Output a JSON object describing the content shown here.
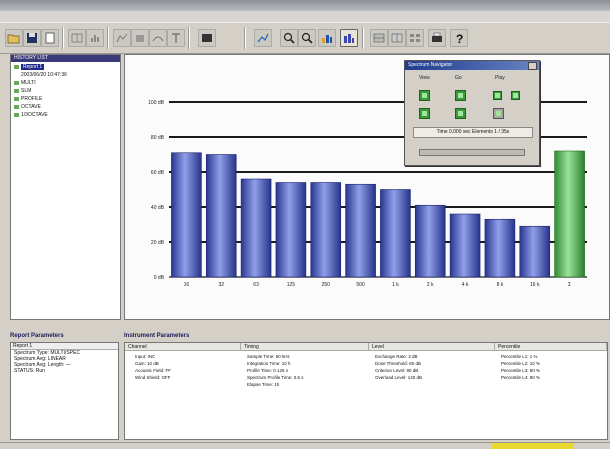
{
  "toolbar": {
    "icons": [
      "open-folder-icon",
      "save-icon",
      "new-document-icon",
      "split-view-icon",
      "histogram-icon",
      "spectrum-icon",
      "bar-icon",
      "text-icon",
      "monitor-icon",
      "chart-icon",
      "zoom-in-icon",
      "zoom-out-icon",
      "bar-graph-icon",
      "spectrum-selected-icon",
      "grid-icon",
      "table-icon",
      "tile-icon",
      "print-icon",
      "help-icon"
    ]
  },
  "tree": {
    "header": "HISTORY LIST",
    "items": [
      {
        "label": "Report 1",
        "selected": true
      },
      {
        "label": "2003/06/20 10:47:36"
      },
      {
        "label": "MULTI"
      },
      {
        "label": "SLM"
      },
      {
        "label": "PROFILE"
      },
      {
        "label": "OCTAVE"
      },
      {
        "label": "1/3OCTAVE"
      }
    ]
  },
  "chart_data": {
    "type": "bar",
    "categories": [
      "16",
      "32",
      "63",
      "125",
      "250",
      "500",
      "1 k",
      "2 k",
      "4 k",
      "8 k",
      "16 k",
      "Σ"
    ],
    "values": [
      71,
      70,
      56,
      54,
      54,
      53,
      50,
      41,
      36,
      33,
      29,
      72
    ],
    "ylim": [
      0,
      120
    ],
    "yticks": [
      0,
      20,
      40,
      60,
      80,
      100
    ],
    "ytick_labels": [
      "0 dB",
      "20 dB",
      "40 dB",
      "60 dB",
      "80 dB",
      "100 dB"
    ],
    "colors": {
      "bar": "#3d4fb0",
      "total": "#45a845"
    },
    "grid": true
  },
  "navigator": {
    "title": "Spectrum Navigator",
    "col_labels": [
      "View",
      "Go",
      "Play"
    ],
    "readout": "Time 0.000 sec Elements 1 / 35s"
  },
  "report": {
    "title": "Report Parameters",
    "header": "Report 1",
    "lines": [
      "Spectrum Type: MULTI/SPEC",
      "Spectrum Avg: LINEAR",
      "Spectrum Avg: Length: —",
      "STATUS: Run"
    ]
  },
  "instr": {
    "title": "Instrument Parameters",
    "columns": [
      "Channel",
      "Timing",
      "Level",
      "Percentile"
    ],
    "channel": [
      "Input: INC",
      "Gain: 10 dB",
      "Acoustic Field: FF",
      "Wind Shield: OFF"
    ],
    "timing": [
      "Sample Time: 60 kHz",
      "Integration Time: 10 h",
      "Profile Time: 0.125 s",
      "Spectrum Profile Time: 0.5 s",
      "Elapse Time: 1h"
    ],
    "level": [
      "Exchange Rate: 3 dB",
      "Dose Threshold: 80 dB",
      "Criterion Level: 90 dB",
      "Overload Level: 140 dB"
    ],
    "percentile": [
      "Percentile L1: 1 %",
      "Percentile L2: 10 %",
      "Percentile L3: 50 %",
      "Percentile L4: 90 %"
    ]
  }
}
